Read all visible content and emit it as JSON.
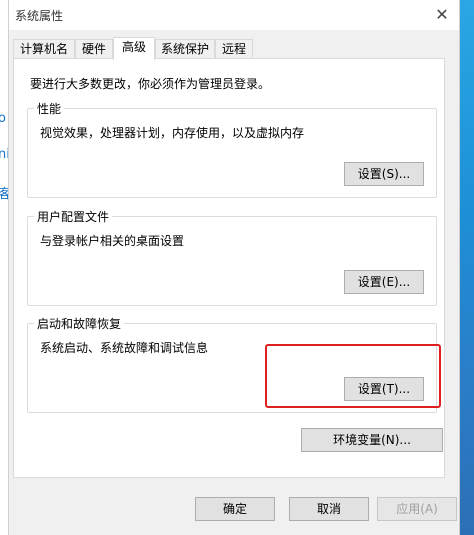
{
  "window": {
    "title": "系统属性",
    "close_glyph": "✕"
  },
  "tabs": [
    {
      "label": "计算机名",
      "active": false
    },
    {
      "label": "硬件",
      "active": false
    },
    {
      "label": "高级",
      "active": true
    },
    {
      "label": "系统保护",
      "active": false
    },
    {
      "label": "远程",
      "active": false
    }
  ],
  "advanced": {
    "notice": "要进行大多数更改，你必须作为管理员登录。",
    "performance": {
      "legend": "性能",
      "description": "视觉效果，处理器计划，内存使用，以及虚拟内存",
      "button": "设置(S)..."
    },
    "user_profiles": {
      "legend": "用户配置文件",
      "description": "与登录帐户相关的桌面设置",
      "button": "设置(E)..."
    },
    "startup_recovery": {
      "legend": "启动和故障恢复",
      "description": "系统启动、系统故障和调试信息",
      "button": "设置(T)..."
    },
    "env_vars_button": "环境变量(N)..."
  },
  "footer": {
    "ok": "确定",
    "cancel": "取消",
    "apply": "应用(A)"
  },
  "background": {
    "left_glyphs": [
      "o",
      "ni",
      "客"
    ]
  },
  "colors": {
    "highlight": "#e02020",
    "dialog_bg": "#f0f0f0",
    "panel_bg": "#ffffff"
  }
}
